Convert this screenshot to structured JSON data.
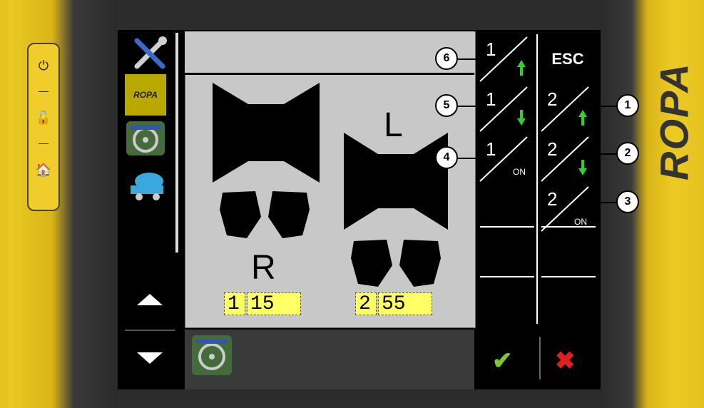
{
  "left_buttons": [
    {
      "name": "power",
      "glyph": "⏻"
    },
    {
      "name": "lock",
      "glyph": "🔓"
    },
    {
      "name": "home",
      "glyph": "🏠"
    }
  ],
  "brand": "ROPA",
  "sidebar": {
    "tools_icon": "✖",
    "ropa_label": "ROPA"
  },
  "main": {
    "left_letter": "R",
    "right_letter": "L",
    "left_index": "1",
    "left_value": "15",
    "right_index": "2",
    "right_value": "55"
  },
  "grid": {
    "esc": "ESC",
    "cells": [
      {
        "num": "1",
        "suffix": "▲"
      },
      {
        "num": "1",
        "suffix": "▼"
      },
      {
        "num": "2",
        "suffix": "▲"
      },
      {
        "num": "1",
        "on": "ON"
      },
      {
        "num": "2",
        "suffix": "▼"
      },
      {
        "num": "2",
        "on": "ON"
      }
    ]
  },
  "footer": {
    "confirm": "✔",
    "cancel": "✖"
  },
  "callouts": [
    "6",
    "5",
    "4",
    "1",
    "2",
    "3"
  ],
  "colors": {
    "accent_green": "#7ec832",
    "cancel_red": "#e02020",
    "value_box": "#ffff66",
    "bezel": "#e6c21e"
  }
}
